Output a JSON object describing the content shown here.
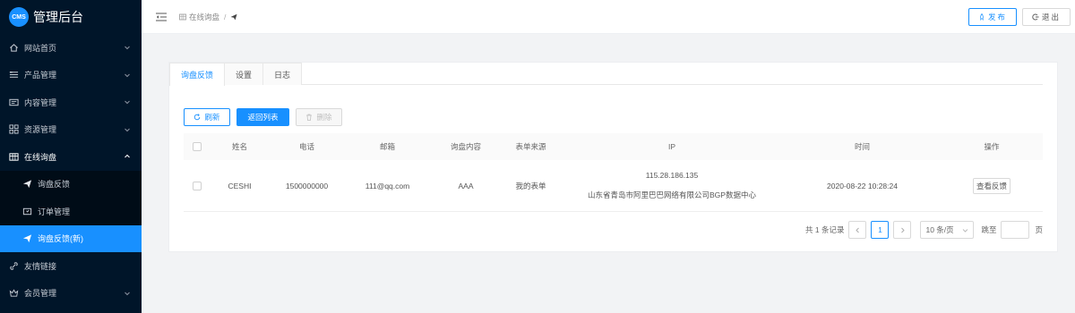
{
  "brand": {
    "logo_text": "CMS",
    "title": "管理后台"
  },
  "sidebar": {
    "items": [
      {
        "label": "网站首页",
        "icon": "home-icon"
      },
      {
        "label": "产品管理",
        "icon": "list-icon"
      },
      {
        "label": "内容管理",
        "icon": "content-icon"
      },
      {
        "label": "资源管理",
        "icon": "grid-icon"
      },
      {
        "label": "在线询盘",
        "icon": "table-icon"
      }
    ],
    "submenu": [
      {
        "label": "询盘反馈",
        "icon": "send-icon"
      },
      {
        "label": "订单管理",
        "icon": "order-icon"
      },
      {
        "label": "询盘反馈(新)",
        "icon": "send-icon"
      }
    ],
    "bottom_items": [
      {
        "label": "友情链接",
        "icon": "link-icon"
      },
      {
        "label": "会员管理",
        "icon": "member-icon"
      }
    ]
  },
  "header": {
    "breadcrumb_root": "在线询盘",
    "breadcrumb_sep": "/",
    "publish_label": "发布",
    "logout_label": "退出"
  },
  "tabs": [
    {
      "label": "询盘反馈"
    },
    {
      "label": "设置"
    },
    {
      "label": "日志"
    }
  ],
  "toolbar": {
    "refresh_label": "刷新",
    "back_label": "返回列表",
    "delete_label": "删除"
  },
  "table": {
    "columns": [
      "姓名",
      "电话",
      "邮箱",
      "询盘内容",
      "表单来源",
      "IP",
      "时间",
      "操作"
    ],
    "rows": [
      {
        "name": "CESHI",
        "phone": "1500000000",
        "email": "111@qq.com",
        "content": "AAA",
        "source": "我的表单",
        "ip": "115.28.186.135",
        "ip_location": "山东省青岛市阿里巴巴网络有限公司BGP数据中心",
        "time": "2020-08-22 10:28:24",
        "action_label": "查看反馈"
      }
    ]
  },
  "pagination": {
    "total_text": "共 1 条记录",
    "current_page": "1",
    "page_size_label": "10 条/页",
    "jump_label": "跳至",
    "page_unit": "页"
  },
  "colors": {
    "primary": "#1890ff",
    "sidebar_bg": "#001529"
  }
}
